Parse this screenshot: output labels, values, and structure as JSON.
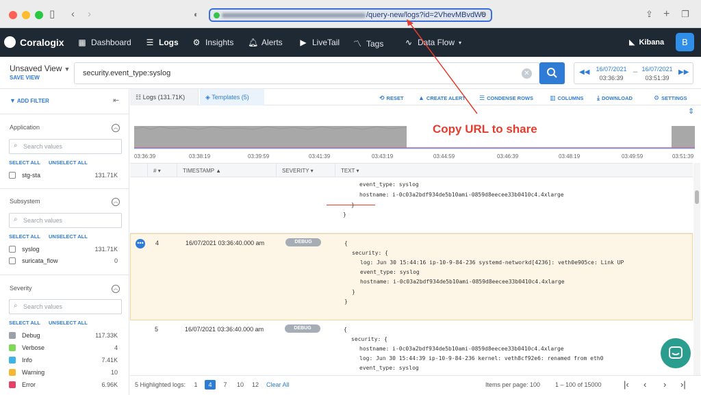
{
  "browser": {
    "url_suffix": "/query-new/logs?id=2VhevMBvdW8",
    "accent": "#3b6fd8"
  },
  "header": {
    "logo": "Coralogix",
    "nav": [
      {
        "label": "Dashboard",
        "icon": "dashboard-icon"
      },
      {
        "label": "Logs",
        "icon": "logs-icon"
      },
      {
        "label": "Insights",
        "icon": "insights-icon"
      },
      {
        "label": "Alerts",
        "icon": "bell-icon"
      },
      {
        "label": "LiveTail",
        "icon": "play-icon"
      },
      {
        "label": "Tags",
        "icon": "tags-icon"
      },
      {
        "label": "Data Flow",
        "icon": "dataflow-icon"
      }
    ],
    "kibana": "Kibana",
    "avatar": "B"
  },
  "query": {
    "view_name": "Unsaved View",
    "save_view": "SAVE VIEW",
    "text": "security.event_type:syslog",
    "date_from": "16/07/2021",
    "time_from": "03:36:39",
    "date_to": "16/07/2021",
    "time_to": "03:51:39"
  },
  "sidebar": {
    "add_filter": "ADD FILTER",
    "search_placeholder": "Search values",
    "select_all": "SELECT ALL",
    "unselect_all": "UNSELECT ALL",
    "sections": [
      {
        "title": "Application",
        "items": [
          {
            "label": "stg-sta",
            "count": "131.71K"
          }
        ]
      },
      {
        "title": "Subsystem",
        "items": [
          {
            "label": "syslog",
            "count": "131.71K"
          },
          {
            "label": "suricata_flow",
            "count": "0"
          }
        ]
      },
      {
        "title": "Severity",
        "items": [
          {
            "label": "Debug",
            "count": "117.33K",
            "color": "#9aa1aa"
          },
          {
            "label": "Verbose",
            "count": "4",
            "color": "#7ed957"
          },
          {
            "label": "Info",
            "count": "7.41K",
            "color": "#3db4e8"
          },
          {
            "label": "Warning",
            "count": "10",
            "color": "#f5b731"
          },
          {
            "label": "Error",
            "count": "6.96K",
            "color": "#e5426a"
          }
        ]
      }
    ]
  },
  "tabs": {
    "logs": "Logs (131.71K)",
    "templates": "Templates (5)"
  },
  "toolbar": {
    "reset": "RESET",
    "create_alert": "CREATE ALERT",
    "condense_rows": "CONDENSE ROWS",
    "columns": "COLUMNS",
    "download": "DOWNLOAD",
    "settings": "SETTINGS"
  },
  "timeline": {
    "labels": [
      "03:36:39",
      "03:38:19",
      "03:39:59",
      "03:41:39",
      "03:43:19",
      "03:44:59",
      "03:46:39",
      "03:48:19",
      "03:49:59",
      "03:51:39"
    ]
  },
  "table": {
    "headers": [
      "#",
      "TIMESTAMP",
      "SEVERITY",
      "TEXT"
    ],
    "row_prev_lines": [
      "event_type: syslog",
      "hostname: i-0c03a2bdf934de5b10ami-0859d8eecee33b0410c4.4xlarge",
      "}",
      "}"
    ],
    "rows": [
      {
        "num": "4",
        "timestamp": "16/07/2021 03:36:40.000 am",
        "severity": "DEBUG",
        "lines": [
          "{",
          "security: {",
          "log: Jun 30 15:44:16 ip-10-9-84-236 systemd-networkd[4236]: veth0e905ce: Link UP",
          "event_type: syslog",
          "hostname: i-0c03a2bdf934de5b10ami-0859d8eecee33b0410c4.4xlarge",
          "}",
          "}"
        ]
      },
      {
        "num": "5",
        "timestamp": "16/07/2021 03:36:40.000 am",
        "severity": "DEBUG",
        "lines": [
          "{",
          "security: {",
          "hostname: i-0c03a2bdf934de5b10ami-0859d8eecee33b0410c4.4xlarge",
          "log: Jun 30 15:44:39 ip-10-9-84-236 kernel: veth8cf92e6: renamed from eth0",
          "event_type: syslog"
        ]
      }
    ]
  },
  "footer": {
    "highlighted": "5 Highlighted logs:",
    "pages": [
      "1",
      "4",
      "7",
      "10",
      "12"
    ],
    "current_page": "4",
    "clear_all": "Clear All",
    "items_per_page": "Items per page: 100",
    "range": "1 – 100 of 15000"
  },
  "annotation": "Copy URL to share",
  "colors": {
    "primary": "#2f7cd6",
    "header_bg": "#1f2933",
    "annotation": "#e53c2e"
  }
}
